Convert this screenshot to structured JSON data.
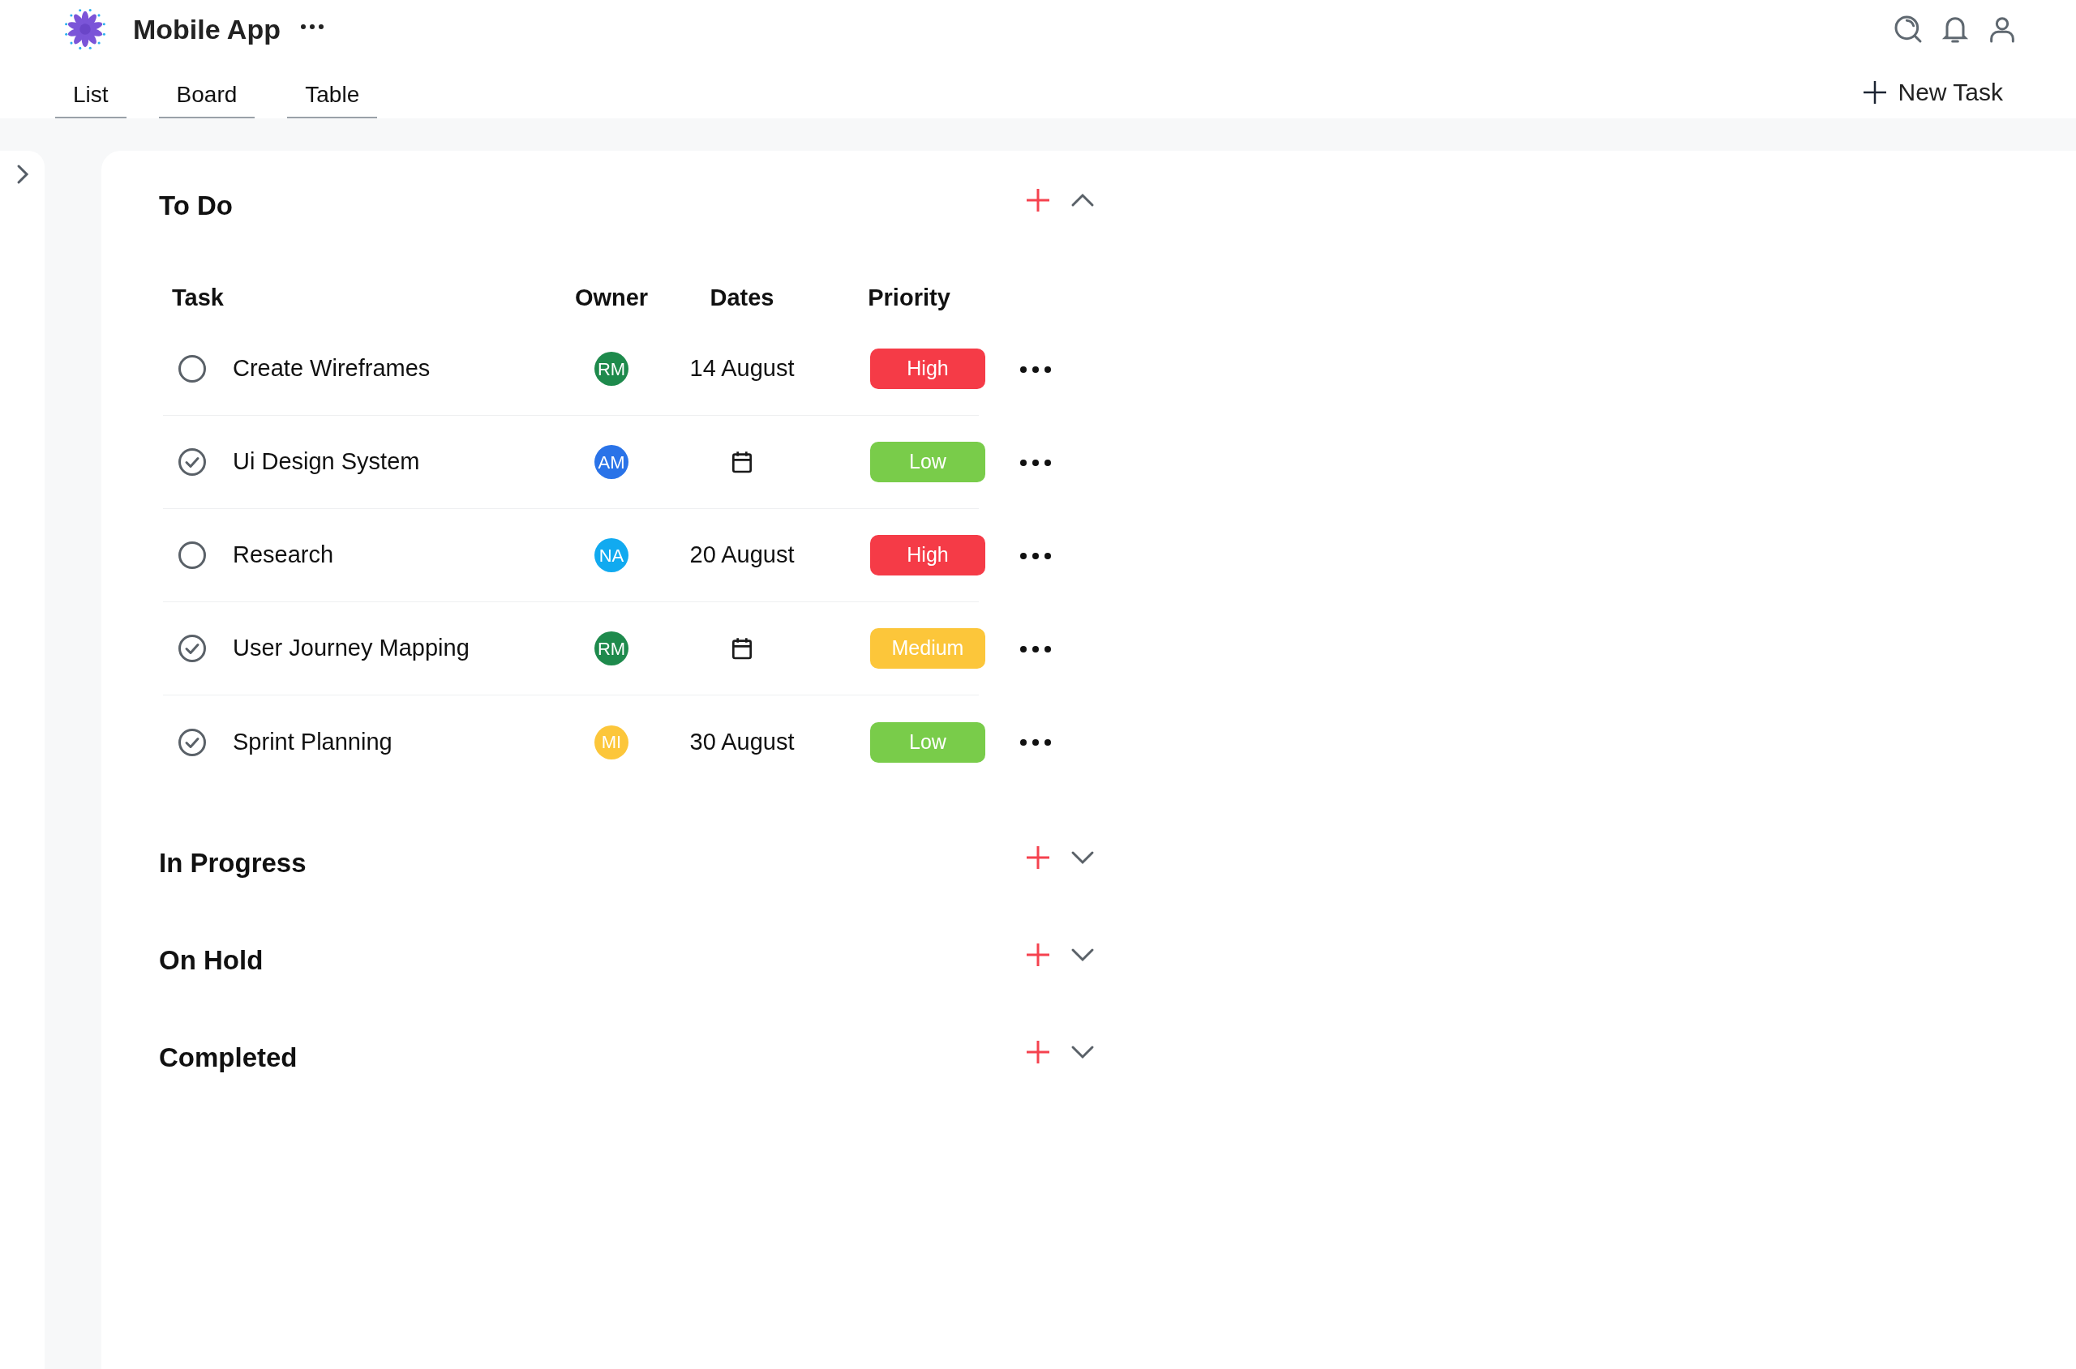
{
  "app": {
    "title": "Mobile App"
  },
  "tabs": [
    {
      "label": "List"
    },
    {
      "label": "Board"
    },
    {
      "label": "Table"
    }
  ],
  "new_task_button": {
    "label": "New Task"
  },
  "sections": [
    {
      "title": "To Do",
      "expanded": true,
      "table": {
        "columns": [
          "Task",
          "Owner",
          "Dates",
          "Priority"
        ],
        "rows": [
          {
            "task": "Create Wireframes",
            "done": false,
            "owner": {
              "initials": "RM",
              "color": "#1e8a4c"
            },
            "date": "14 August",
            "priority": {
              "label": "High",
              "color": "#f53b47"
            }
          },
          {
            "task": "Ui Design System",
            "done": true,
            "owner": {
              "initials": "AM",
              "color": "#2a73e8"
            },
            "priority": {
              "label": "Low",
              "color": "#79cc4a"
            }
          },
          {
            "task": "Research",
            "done": false,
            "owner": {
              "initials": "NA",
              "color": "#11aaf0"
            },
            "date": "20 August",
            "priority": {
              "label": "High",
              "color": "#f53b47"
            }
          },
          {
            "task": "User Journey Mapping",
            "done": true,
            "owner": {
              "initials": "RM",
              "color": "#1e8a4c"
            },
            "priority": {
              "label": "Medium",
              "color": "#fcc63a"
            }
          },
          {
            "task": "Sprint Planning",
            "done": true,
            "owner": {
              "initials": "MI",
              "color": "#fcc63a"
            },
            "date": "30 August",
            "priority": {
              "label": "Low",
              "color": "#79cc4a"
            }
          }
        ]
      }
    },
    {
      "title": "In Progress",
      "expanded": false
    },
    {
      "title": "On Hold",
      "expanded": false
    },
    {
      "title": "Completed",
      "expanded": false
    }
  ]
}
